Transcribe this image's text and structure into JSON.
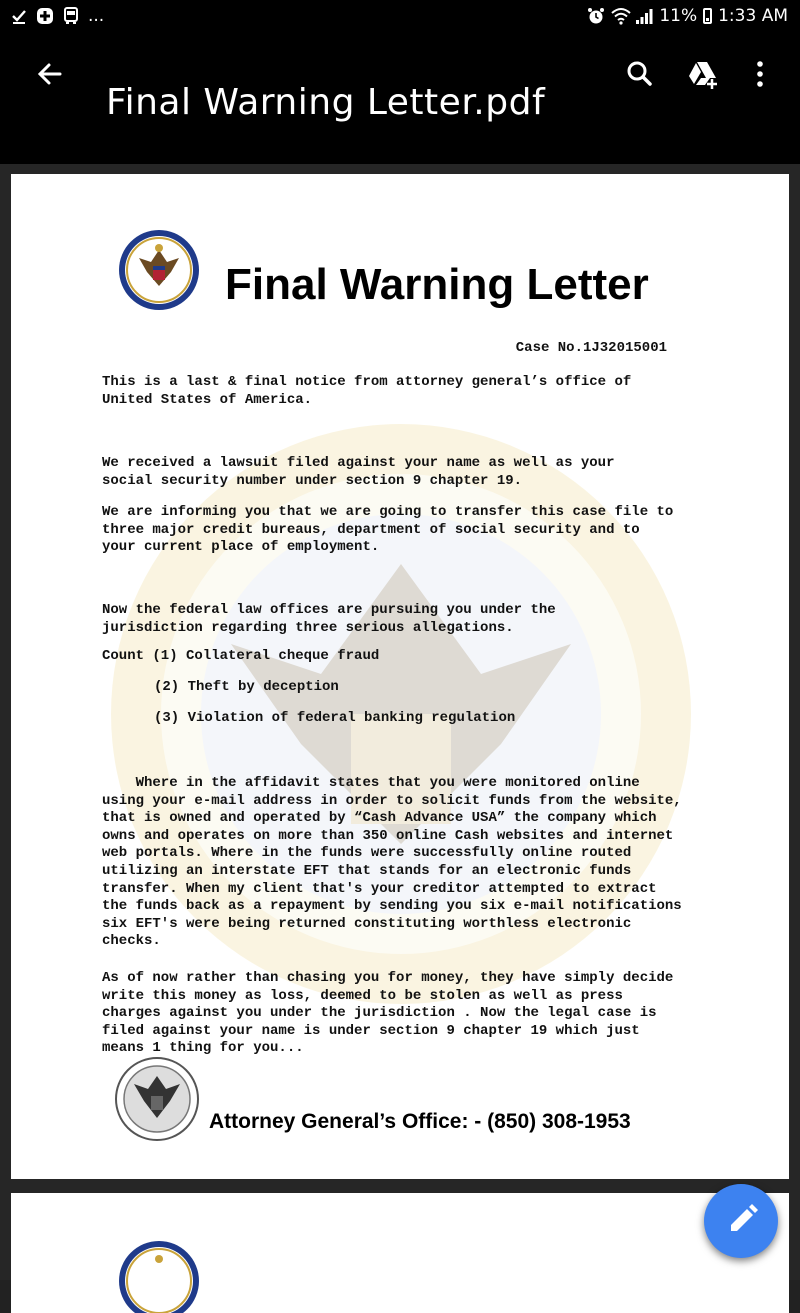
{
  "status_bar": {
    "overflow": "...",
    "battery_pct": "11%",
    "time": "1:33 AM"
  },
  "app_bar": {
    "title": "Final Warning Letter.pdf",
    "icons": [
      "back-arrow-icon",
      "search-icon",
      "drive-add-icon",
      "more-vert-icon"
    ]
  },
  "letter": {
    "heading": "Final Warning Letter",
    "case_no": "Case No.1J32015001",
    "para1": "This is a last & final notice from attorney general’s office of\nUnited States of America.",
    "para2": "We received a lawsuit filed against your name as well as your\nsocial security number under section 9 chapter 19.",
    "para3": "We are informing you that we are going to transfer this case file to\nthree major credit bureaus, department of social security and to\nyour current place of employment.",
    "para4": "Now the federal law offices are pursuing you under the\njurisdiction regarding three serious allegations.",
    "count1": "Count (1) Collateral cheque fraud",
    "count2": "(2) Theft by deception",
    "count3": "(3) Violation of federal banking regulation",
    "para5": "    Where in the affidavit states that you were monitored online\nusing your e-mail address in order to solicit funds from the website,\nthat is owned and operated by “Cash Advance USA” the company which\nowns and operates on more than 350 online Cash websites and internet\nweb portals. Where in the funds were successfully online routed\nutilizing an interstate EFT that stands for an electronic funds\ntransfer. When my client that's your creditor attempted to extract\nthe funds back as a repayment by sending you six e-mail notifications\nsix EFT's were being returned constituting worthless electronic\nchecks.",
    "para6": "As of now rather than chasing you for money, they have simply decide\nwrite this money as loss, deemed to be stolen as well as press\ncharges against you under the jurisdiction . Now the legal case is\nfiled against your name is under section 9 chapter 19 which just\nmeans 1 thing for you...",
    "footer": "Attorney General’s Office: - (850) 308-1953",
    "seal_text": "DEPARTMENT OF STATE · UNITED STATES OF AMERICA"
  },
  "colors": {
    "app_bar": "#000000",
    "fab": "#3d82f0",
    "seal_blue": "#1f3a8a",
    "seal_gold": "#c9a33a"
  }
}
